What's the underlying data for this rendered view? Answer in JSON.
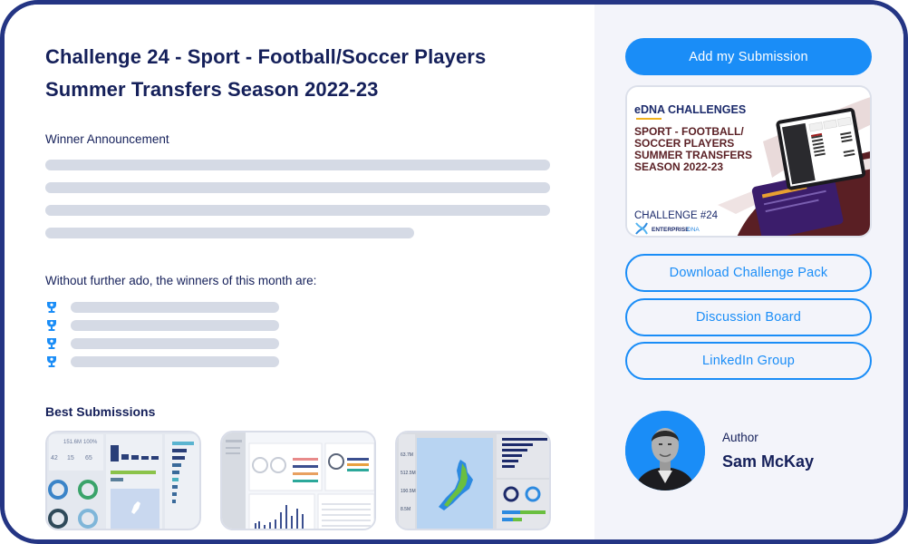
{
  "challenge": {
    "title_line1": "Challenge 24 - Sport - Football/Soccer Players",
    "title_line2": "Summer Transfers Season 2022-23"
  },
  "winner_section": {
    "heading": "Winner Announcement",
    "placeholder_lines": 4
  },
  "winners": {
    "intro": "Without further ado, the winners of this month are:",
    "count": 4,
    "icon": "trophy-icon"
  },
  "best_submissions": {
    "heading": "Best Submissions",
    "thumbnails": [
      {
        "name": "submission-thumbnail-1",
        "kind": "dashboard"
      },
      {
        "name": "submission-thumbnail-2",
        "kind": "dashboard"
      },
      {
        "name": "submission-thumbnail-3",
        "kind": "map-dashboard"
      }
    ]
  },
  "sidebar": {
    "add_submission_label": "Add my Submission",
    "banner": {
      "brand": "eDNA CHALLENGES",
      "headline": [
        "SPORT - FOOTBALL/",
        "SOCCER PLAYERS",
        "SUMMER TRANSFERS",
        "SEASON 2022-23"
      ],
      "challenge_number": "CHALLENGE #24",
      "logo_text_bold": "ENTERPRISE",
      "logo_text_light": "DNA"
    },
    "links": [
      {
        "label": "Download Challenge Pack"
      },
      {
        "label": "Discussion Board"
      },
      {
        "label": "LinkedIn Group"
      }
    ],
    "author": {
      "label": "Author",
      "name": "Sam McKay"
    }
  },
  "colors": {
    "frame": "#243584",
    "text_dark": "#15205a",
    "accent_blue": "#1a8df7",
    "placeholder": "#d5dae5",
    "sidebar_bg": "#f3f4fa",
    "banner_maroon": "#5a1f24"
  }
}
